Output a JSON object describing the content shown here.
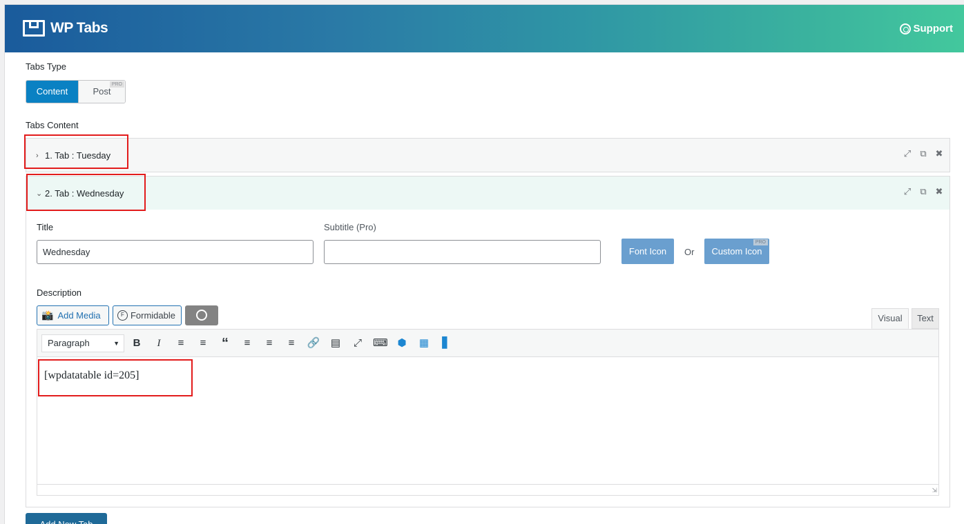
{
  "header": {
    "title": "WP Tabs",
    "support_label": "Support"
  },
  "tabs_type": {
    "label": "Tabs Type",
    "options": [
      {
        "label": "Content",
        "active": true
      },
      {
        "label": "Post",
        "badge": "PRO"
      }
    ]
  },
  "tabs_content": {
    "label": "Tabs Content",
    "items": [
      {
        "title": "1. Tab : Tuesday",
        "expanded": false
      },
      {
        "title": "2. Tab : Wednesday",
        "expanded": true
      }
    ]
  },
  "tab_form": {
    "title_label": "Title",
    "title_value": "Wednesday",
    "subtitle_label": "Subtitle (Pro)",
    "subtitle_value": "",
    "font_icon_label": "Font Icon",
    "or_label": "Or",
    "custom_icon_label": "Custom Icon",
    "custom_icon_badge": "PRO",
    "description_label": "Description"
  },
  "editor": {
    "add_media_label": "Add Media",
    "formidable_label": "Formidable",
    "visual_tab": "Visual",
    "text_tab": "Text",
    "format_select": "Paragraph",
    "content": "[wpdatatable id=205]"
  },
  "footer": {
    "add_tab_label": "Add New Tab"
  },
  "colors": {
    "accent": "#0a81c3",
    "highlight_box": "#e21b1b",
    "icon_button": "#6a9fcf"
  }
}
